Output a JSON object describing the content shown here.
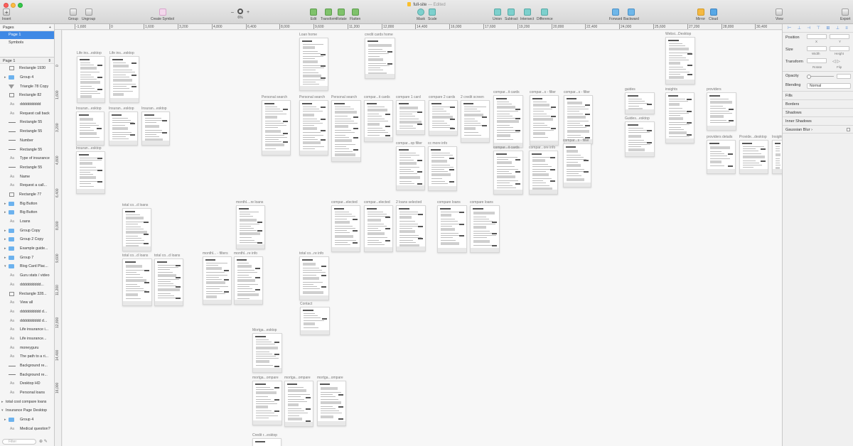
{
  "window": {
    "doc_name": "full-site",
    "doc_status": "— Edited"
  },
  "toolbar": {
    "insert": "Insert",
    "group": "Group",
    "ungroup": "Ungroup",
    "create_symbol": "Create Symbol",
    "zoom_minus": "–",
    "zoom_plus": "+",
    "zoom_value": "6%",
    "edit": "Edit",
    "transform": "Transform",
    "rotate": "Rotate",
    "flatten": "Flatten",
    "mask": "Mask",
    "scale": "Scale",
    "union": "Union",
    "subtract": "Subtract",
    "intersect": "Intersect",
    "difference": "Difference",
    "forward": "Forward",
    "backward": "Backward",
    "mirror": "Mirror",
    "cloud": "Cloud",
    "view": "View",
    "export": "Export"
  },
  "pages_panel": {
    "header": "Pages",
    "add": "+",
    "pages": [
      "Page 1",
      "Symbols"
    ],
    "current": "Page 1"
  },
  "layers": [
    {
      "label": "Rectangle 1930",
      "kind": "rect",
      "folder": false
    },
    {
      "label": "Group 4",
      "kind": "folder",
      "folder": true
    },
    {
      "label": "Triangle 78 Copy",
      "kind": "triangle",
      "folder": false
    },
    {
      "label": "Rectangle 82",
      "kind": "rect",
      "folder": false
    },
    {
      "label": "dddddddddd",
      "kind": "text",
      "folder": false
    },
    {
      "label": "Request call back",
      "kind": "text",
      "folder": false
    },
    {
      "label": "Rectangle 55",
      "kind": "line",
      "folder": false
    },
    {
      "label": "Rectangle 55",
      "kind": "line",
      "folder": false
    },
    {
      "label": "Number",
      "kind": "line",
      "folder": false
    },
    {
      "label": "Rectangle 55",
      "kind": "line",
      "folder": false
    },
    {
      "label": "Type of insurance",
      "kind": "text",
      "folder": false
    },
    {
      "label": "Rectangle 55",
      "kind": "line",
      "folder": false
    },
    {
      "label": "Name",
      "kind": "text",
      "folder": false
    },
    {
      "label": "Request a call...",
      "kind": "text",
      "folder": false
    },
    {
      "label": "Rectangle 77",
      "kind": "rect",
      "folder": false
    },
    {
      "label": "Big Button",
      "kind": "folder",
      "folder": true
    },
    {
      "label": "Big Button",
      "kind": "folder",
      "folder": true
    },
    {
      "label": "Loans",
      "kind": "text",
      "folder": false
    },
    {
      "label": "Group Copy",
      "kind": "folder",
      "folder": true
    },
    {
      "label": "Group 2 Copy",
      "kind": "folder",
      "folder": true
    },
    {
      "label": "Example guide...",
      "kind": "folder",
      "folder": true
    },
    {
      "label": "Group 7",
      "kind": "folder",
      "folder": true
    },
    {
      "label": "Blog Card Plac...",
      "kind": "folder",
      "folder": true,
      "expanded": true
    },
    {
      "label": "Guru stats / video",
      "kind": "text",
      "folder": false
    },
    {
      "label": "dddddddddd...",
      "kind": "text",
      "folder": false
    },
    {
      "label": "Rectangle 328...",
      "kind": "rect",
      "folder": false
    },
    {
      "label": "View all",
      "kind": "text",
      "folder": false
    },
    {
      "label": "dddddddddd d...",
      "kind": "text",
      "folder": false
    },
    {
      "label": "dddddddddd d...",
      "kind": "text",
      "folder": false
    },
    {
      "label": "Life insurance i...",
      "kind": "text",
      "folder": false
    },
    {
      "label": "Life insurance...",
      "kind": "text",
      "folder": false
    },
    {
      "label": "moneyguru",
      "kind": "text",
      "folder": false
    },
    {
      "label": "The path to a ri...",
      "kind": "text",
      "folder": false
    },
    {
      "label": "Background re...",
      "kind": "line",
      "folder": false
    },
    {
      "label": "Background re...",
      "kind": "line",
      "folder": false
    },
    {
      "label": "Desktop HD",
      "kind": "text",
      "folder": false
    },
    {
      "label": "Personal loans",
      "kind": "text",
      "folder": false
    },
    {
      "label": "total cost compare loans",
      "kind": "artboard",
      "folder": true
    },
    {
      "label": "Insurance Page Desktop",
      "kind": "artboard",
      "folder": true,
      "expanded": true
    },
    {
      "label": "Group 4",
      "kind": "folder",
      "folder": true
    },
    {
      "label": "Medical question?",
      "kind": "text",
      "folder": false
    }
  ],
  "layers_panel": {
    "page_label": "Page 1",
    "filter_placeholder": "Filter"
  },
  "ruler": {
    "x_ticks": [
      "-1,600",
      "0",
      "1,600",
      "3,200",
      "4,800",
      "6,400",
      "8,000",
      "9,600",
      "11,200",
      "12,800",
      "14,400",
      "16,000",
      "17,600",
      "19,200",
      "20,800",
      "22,400",
      "24,000",
      "25,600",
      "27,200",
      "28,800",
      "30,400",
      "32,000"
    ],
    "y_ticks": [
      "0",
      "1,600",
      "3,200",
      "4,800",
      "6,400",
      "8,000",
      "9,600",
      "11,200",
      "12,800",
      "14,400",
      "16,000"
    ]
  },
  "artboards": [
    {
      "label": "Life ins...esktop"
    },
    {
      "label": "Life ins...esktop"
    },
    {
      "label": "Insuran...esktop"
    },
    {
      "label": "Insuran...esktop"
    },
    {
      "label": "Insuran...esktop"
    },
    {
      "label": "Insuran...esktop"
    },
    {
      "label": "Loan home"
    },
    {
      "label": "credit cards home"
    },
    {
      "label": "Personal search"
    },
    {
      "label": "Personal search"
    },
    {
      "label": "Personal search"
    },
    {
      "label": "compar...it cards"
    },
    {
      "label": "compare 1 card"
    },
    {
      "label": "compare 2 cards"
    },
    {
      "label": "2 credit screen"
    },
    {
      "label": "compar...it cards"
    },
    {
      "label": "compar...s - filter"
    },
    {
      "label": "compar...s - filter"
    },
    {
      "label": "compar...op filter"
    },
    {
      "label": "cc more info"
    },
    {
      "label": "compar...it cards"
    },
    {
      "label": "compar...ore info"
    },
    {
      "label": "compar...s - filter"
    },
    {
      "label": "guides"
    },
    {
      "label": "Guides...esktop"
    },
    {
      "label": "insights"
    },
    {
      "label": "providers"
    },
    {
      "label": "providers details"
    },
    {
      "label": "Provide...desktop"
    },
    {
      "label": "Insight"
    },
    {
      "label": "Websi...Desktop"
    },
    {
      "label": "total co...d loans"
    },
    {
      "label": "total co...d loans"
    },
    {
      "label": "total co...d loans"
    },
    {
      "label": "monthl....re loans"
    },
    {
      "label": "monthl... - filters"
    },
    {
      "label": "monthl...re info"
    },
    {
      "label": "total co...re info"
    },
    {
      "label": "compar...elected"
    },
    {
      "label": "compar...elected"
    },
    {
      "label": "2 loans selected"
    },
    {
      "label": "compare loans"
    },
    {
      "label": "compare loans"
    },
    {
      "label": "Contact"
    },
    {
      "label": "Mortga...esktop"
    },
    {
      "label": "mortga...ompare"
    },
    {
      "label": "mortga...ompare"
    },
    {
      "label": "mortga...ompare"
    },
    {
      "label": "Credit r...esktop"
    }
  ],
  "inspector": {
    "position": "Position",
    "x": "X",
    "y": "Y",
    "size": "Size",
    "width": "Width",
    "height": "Height",
    "transform": "Transform",
    "rotate": "Rotate",
    "flip": "Flip",
    "opacity": "Opacity",
    "blending": "Blending",
    "blending_value": "Normal",
    "sections": [
      "Fills",
      "Borders",
      "Shadows",
      "Inner Shadows"
    ],
    "gaussian": "Gaussian Blur"
  }
}
